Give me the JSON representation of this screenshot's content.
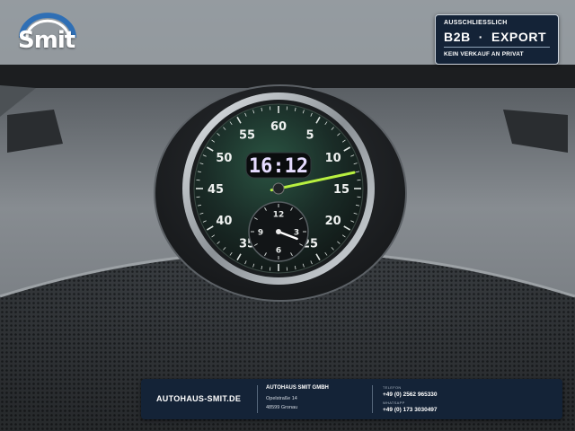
{
  "logo": {
    "text": "Smit"
  },
  "badge": {
    "top": "AUSSCHLIESSLICH",
    "main": "B2B  ·  EXPORT",
    "bottom": "KEIN VERKAUF AN PRIVAT"
  },
  "clock": {
    "digital_time": "16:12",
    "stopwatch_labels": [
      "60",
      "5",
      "10",
      "15",
      "20",
      "25",
      "35",
      "40",
      "45",
      "50",
      "55"
    ],
    "subdial_labels": [
      "12",
      "3",
      "6",
      "9"
    ],
    "stopwatch_hand_seconds": 13,
    "subdial_hand_hours": 3.7
  },
  "footer": {
    "website": "AUTOHAUS-SMIT.DE",
    "company": "AUTOHAUS SMIT GMBH",
    "street": "Opelstraße 14",
    "city": "48599 Gronau",
    "phone_label": "TELEFON",
    "phone": "+49 (0) 2562 965330",
    "whatsapp_label": "WHATSAPP",
    "whatsapp": "+49 (0) 173 3030497"
  },
  "colors": {
    "badge_bg": "#142337",
    "hand_green": "#b8f040",
    "digital_text": "#e6dcff"
  }
}
